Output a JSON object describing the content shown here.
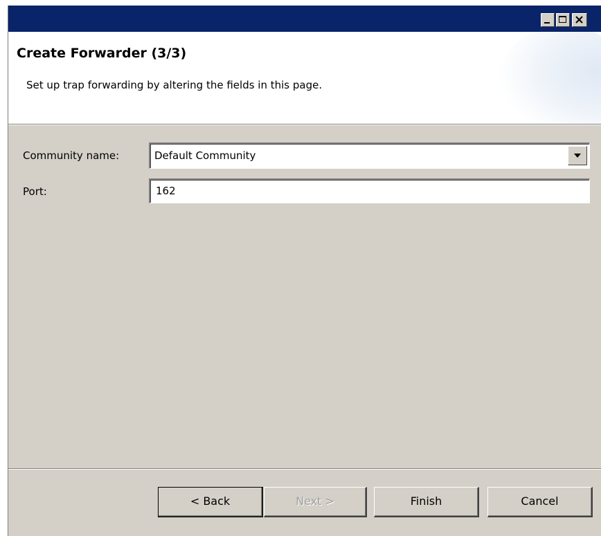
{
  "window": {
    "title_bar_color": "#0a246a",
    "controls": [
      "minimize-icon",
      "maximize-icon",
      "close-icon"
    ]
  },
  "banner": {
    "title": "Create Forwarder (3/3)",
    "description": "Set up trap forwarding by altering the fields in this page."
  },
  "form": {
    "community": {
      "label": "Community name:",
      "value": "Default Community"
    },
    "port": {
      "label": "Port:",
      "value": "162"
    }
  },
  "buttons": {
    "back": "< Back",
    "next": "Next >",
    "finish": "Finish",
    "cancel": "Cancel"
  },
  "colors": {
    "dialog_background": "#d4d0c8",
    "disabled_text": "#a0a0a0"
  }
}
